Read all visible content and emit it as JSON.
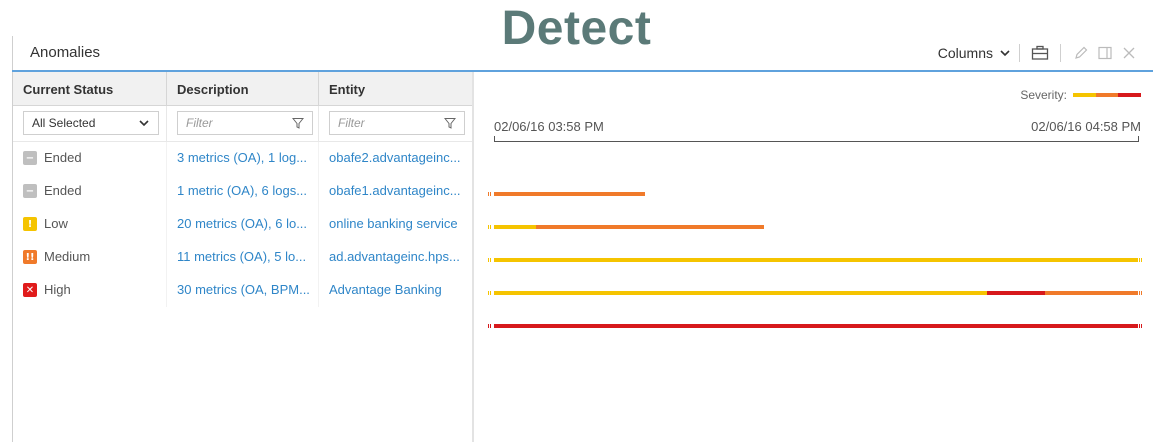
{
  "overlay_title": "Detect",
  "panel": {
    "title": "Anomalies",
    "columns_label": "Columns"
  },
  "grid": {
    "headers": {
      "status": "Current Status",
      "description": "Description",
      "entity": "Entity"
    },
    "filters": {
      "status_value": "All Selected",
      "description_placeholder": "Filter",
      "entity_placeholder": "Filter"
    },
    "rows": [
      {
        "status": "Ended",
        "status_icon": "ended-icon",
        "status_color": "#bfbfbf",
        "description": "3 metrics (OA), 1 log...",
        "entity": "obafe2.advantageinc..."
      },
      {
        "status": "Ended",
        "status_icon": "ended-icon",
        "status_color": "#bfbfbf",
        "description": "1 metric (OA), 6 logs...",
        "entity": "obafe1.advantageinc..."
      },
      {
        "status": "Low",
        "status_icon": "warning-icon",
        "status_color": "#f5c400",
        "description": "20 metrics (OA), 6 lo...",
        "entity": "online banking service"
      },
      {
        "status": "Medium",
        "status_icon": "double-warning-icon",
        "status_color": "#f07a2a",
        "description": "11 metrics (OA), 5 lo...",
        "entity": "ad.advantageinc.hps..."
      },
      {
        "status": "High",
        "status_icon": "close-icon",
        "status_color": "#e01b1b",
        "description": "30 metrics (OA, BPM...",
        "entity": "Advantage Banking"
      }
    ]
  },
  "timeline": {
    "severity_label": "Severity:",
    "start_label": "02/06/16 03:58 PM",
    "end_label": "02/06/16 04:58 PM",
    "colors": {
      "low": "#f5c400",
      "medium": "#f07a2a",
      "high": "#d7191c"
    },
    "tracks": [
      {
        "segments": [
          {
            "from": 0.0,
            "to": 0.235,
            "severity": "medium"
          }
        ]
      },
      {
        "segments": [
          {
            "from": 0.0,
            "to": 0.065,
            "severity": "low"
          },
          {
            "from": 0.065,
            "to": 0.42,
            "severity": "medium"
          }
        ]
      },
      {
        "segments": [
          {
            "from": 0.0,
            "to": 1.0,
            "severity": "low"
          }
        ]
      },
      {
        "segments": [
          {
            "from": 0.0,
            "to": 0.765,
            "severity": "low"
          },
          {
            "from": 0.765,
            "to": 0.855,
            "severity": "high"
          },
          {
            "from": 0.855,
            "to": 1.0,
            "severity": "medium"
          }
        ]
      },
      {
        "segments": [
          {
            "from": 0.0,
            "to": 1.0,
            "severity": "high"
          }
        ]
      }
    ]
  }
}
